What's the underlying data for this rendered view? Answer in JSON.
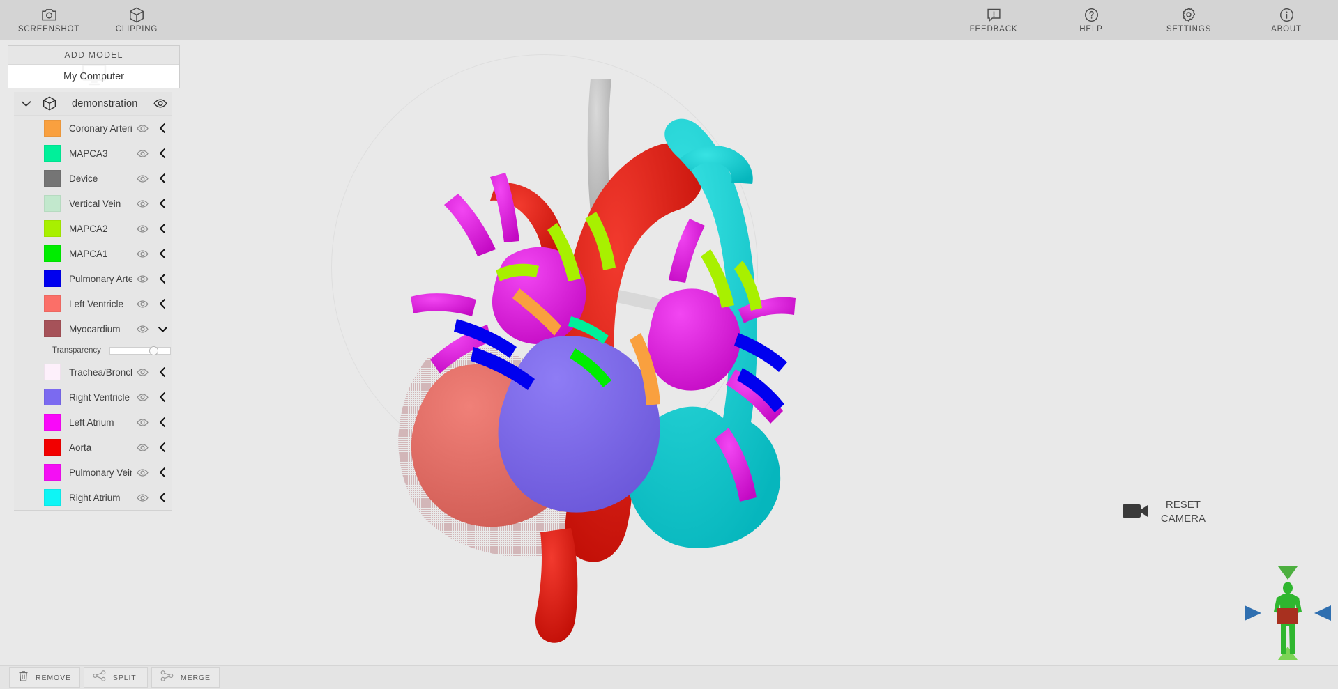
{
  "app": {
    "background": "#e9e9e9",
    "panel_bg": "#e6e6e6"
  },
  "toolbar": {
    "left_items": [
      {
        "label": "SCREENSHOT",
        "icon": "camera-icon"
      },
      {
        "label": "CLIPPING",
        "icon": "cube-icon"
      }
    ],
    "right_items": [
      {
        "label": "FEEDBACK",
        "icon": "feedback-icon"
      },
      {
        "label": "HELP",
        "icon": "question-circle-icon"
      },
      {
        "label": "SETTINGS",
        "icon": "gear-icon"
      },
      {
        "label": "ABOUT",
        "icon": "info-circle-icon"
      }
    ]
  },
  "add_model": {
    "header": "ADD MODEL",
    "source_label": "My Computer",
    "watermark_icon": "monitor-icon"
  },
  "tree": {
    "root_label": "demonstration",
    "root_icon": "cube-icon",
    "root_caret": "chevron-down-icon",
    "root_eye": "eye-icon",
    "layers": [
      {
        "name": "Coronary Arteries",
        "color": "#f9a03f",
        "eye": "eye-icon",
        "chevron": "chevron-left-icon",
        "expanded": false
      },
      {
        "name": "MAPCA3",
        "color": "#00f09a",
        "eye": "eye-icon",
        "chevron": "chevron-left-icon",
        "expanded": false
      },
      {
        "name": "Device",
        "color": "#757575",
        "eye": "eye-icon",
        "chevron": "chevron-left-icon",
        "expanded": false
      },
      {
        "name": "Vertical Vein",
        "color": "#c2e8cd",
        "eye": "eye-icon",
        "chevron": "chevron-left-icon",
        "expanded": false
      },
      {
        "name": "MAPCA2",
        "color": "#a8f000",
        "eye": "eye-icon",
        "chevron": "chevron-left-icon",
        "expanded": false
      },
      {
        "name": "MAPCA1",
        "color": "#00ed00",
        "eye": "eye-icon",
        "chevron": "chevron-left-icon",
        "expanded": false
      },
      {
        "name": "Pulmonary Arteries",
        "color": "#0000ef",
        "eye": "eye-icon",
        "chevron": "chevron-left-icon",
        "expanded": false
      },
      {
        "name": "Left Ventricle",
        "color": "#fb6f68",
        "eye": "eye-icon",
        "chevron": "chevron-left-icon",
        "expanded": false
      },
      {
        "name": "Myocardium",
        "color": "#a65259",
        "eye": "eye-icon",
        "chevron": "chevron-down-icon",
        "expanded": true,
        "transparency": {
          "label": "Transparency",
          "value": 76
        }
      },
      {
        "name": "Trachea/Bronchi",
        "color": "#fdf0fb",
        "eye": "eye-icon",
        "chevron": "chevron-left-icon",
        "expanded": false
      },
      {
        "name": "Right Ventricle",
        "color": "#7b6af0",
        "eye": "eye-icon",
        "chevron": "chevron-left-icon",
        "expanded": false
      },
      {
        "name": "Left Atrium",
        "color": "#f909f9",
        "eye": "eye-icon",
        "chevron": "chevron-left-icon",
        "expanded": false
      },
      {
        "name": "Aorta",
        "color": "#f20000",
        "eye": "eye-icon",
        "chevron": "chevron-left-icon",
        "expanded": false
      },
      {
        "name": "Pulmonary Veins",
        "color": "#f40ff4",
        "eye": "eye-icon",
        "chevron": "chevron-left-icon",
        "expanded": false
      },
      {
        "name": "Right Atrium",
        "color": "#0ef5f5",
        "eye": "eye-icon",
        "chevron": "chevron-left-icon",
        "expanded": false
      }
    ]
  },
  "bottom_toolbar": {
    "buttons": [
      {
        "label": "REMOVE",
        "icon": "trash-icon"
      },
      {
        "label": "SPLIT",
        "icon": "split-icon"
      },
      {
        "label": "MERGE",
        "icon": "merge-icon"
      }
    ]
  },
  "viewport": {
    "reset_camera_label_line1": "RESET",
    "reset_camera_label_line2": "CAMERA",
    "camera_icon": "video-camera-icon",
    "orientation_widget": {
      "figure_color": "#2fb62f",
      "band_color": "#a8301f",
      "arrow_color": "#2f6fb0",
      "arrow_top_color": "#4caf3f",
      "arrow_bottom_color": "#7cd455"
    }
  }
}
